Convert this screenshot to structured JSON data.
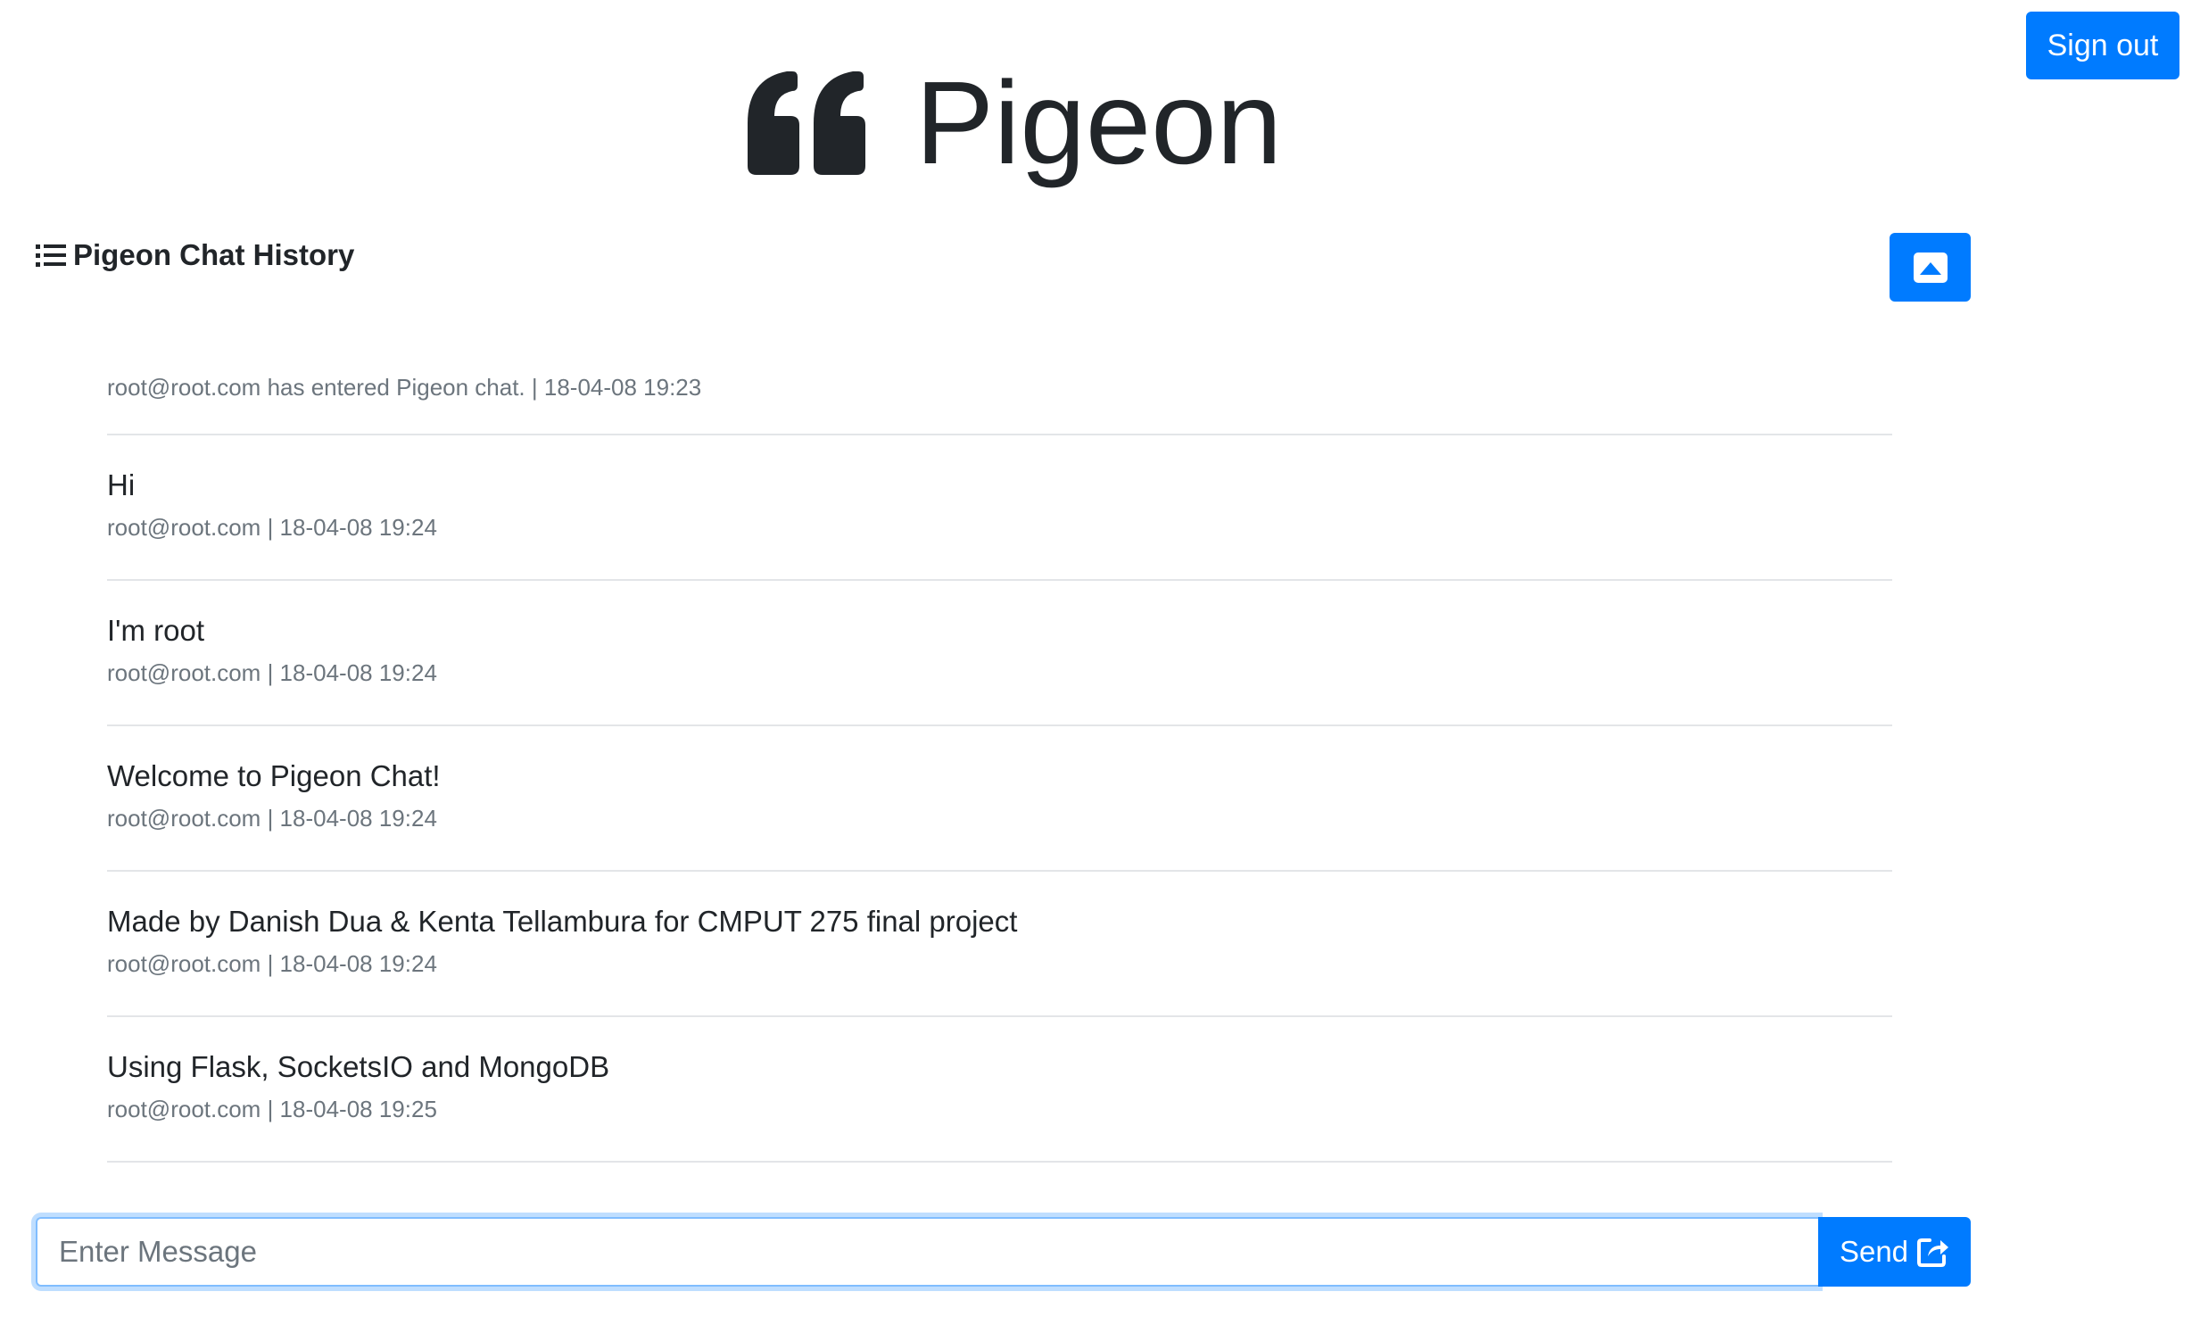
{
  "header": {
    "sign_out_label": "Sign out"
  },
  "brand": {
    "title": "Pigeon",
    "icon": "quote-left-icon"
  },
  "history": {
    "heading": "Pigeon Chat History",
    "heading_icon": "list-icon",
    "collapse_icon": "caret-square-up-icon",
    "messages": [
      {
        "type": "system",
        "text": "",
        "meta": "root@root.com has entered Pigeon chat. | 18-04-08 19:23"
      },
      {
        "type": "user",
        "text": "Hi",
        "meta": "root@root.com | 18-04-08 19:24"
      },
      {
        "type": "user",
        "text": "I'm root",
        "meta": "root@root.com | 18-04-08 19:24"
      },
      {
        "type": "user",
        "text": "Welcome to Pigeon Chat!",
        "meta": "root@root.com | 18-04-08 19:24"
      },
      {
        "type": "user",
        "text": "Made by Danish Dua & Kenta Tellambura for CMPUT 275 final project",
        "meta": "root@root.com | 18-04-08 19:24"
      },
      {
        "type": "user",
        "text": "Using Flask, SocketsIO and MongoDB",
        "meta": "root@root.com | 18-04-08 19:25"
      }
    ]
  },
  "composer": {
    "placeholder": "Enter Message",
    "value": "",
    "send_label": "Send",
    "send_icon": "share-square-icon"
  },
  "colors": {
    "primary": "#007bff",
    "text": "#212529",
    "muted": "#6c757d",
    "divider": "#e3e5e8",
    "focus_border": "#80bdff"
  }
}
